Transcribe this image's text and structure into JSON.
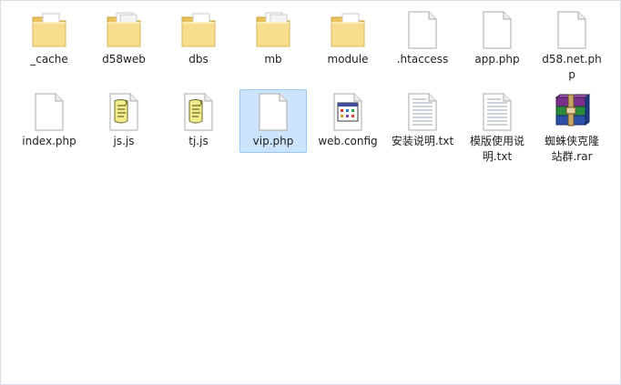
{
  "files": [
    {
      "name": "_cache",
      "type": "folder-icon"
    },
    {
      "name": "d58web",
      "type": "folder-icon"
    },
    {
      "name": "dbs",
      "type": "folder-icon"
    },
    {
      "name": "mb",
      "type": "folder-icon"
    },
    {
      "name": "module",
      "type": "folder-icon"
    },
    {
      "name": ".htaccess",
      "type": "blank-file-icon"
    },
    {
      "name": "app.php",
      "type": "blank-file-icon"
    },
    {
      "name": "d58.net.php",
      "type": "blank-file-icon"
    },
    {
      "name": "index.php",
      "type": "blank-file-icon"
    },
    {
      "name": "js.js",
      "type": "script-file-icon"
    },
    {
      "name": "tj.js",
      "type": "script-file-icon"
    },
    {
      "name": "vip.php",
      "type": "blank-file-icon",
      "selected": true
    },
    {
      "name": "web.config",
      "type": "config-file-icon"
    },
    {
      "name": "安装说明.txt",
      "type": "text-file-icon"
    },
    {
      "name": "模版使用说明.txt",
      "type": "text-file-icon"
    },
    {
      "name": "蜘蛛侠克隆站群.rar",
      "type": "archive-file-icon"
    }
  ],
  "colors": {
    "selection_bg": "#cce4fb",
    "selection_border": "#99c9ef",
    "folder": "#f1d47f"
  }
}
